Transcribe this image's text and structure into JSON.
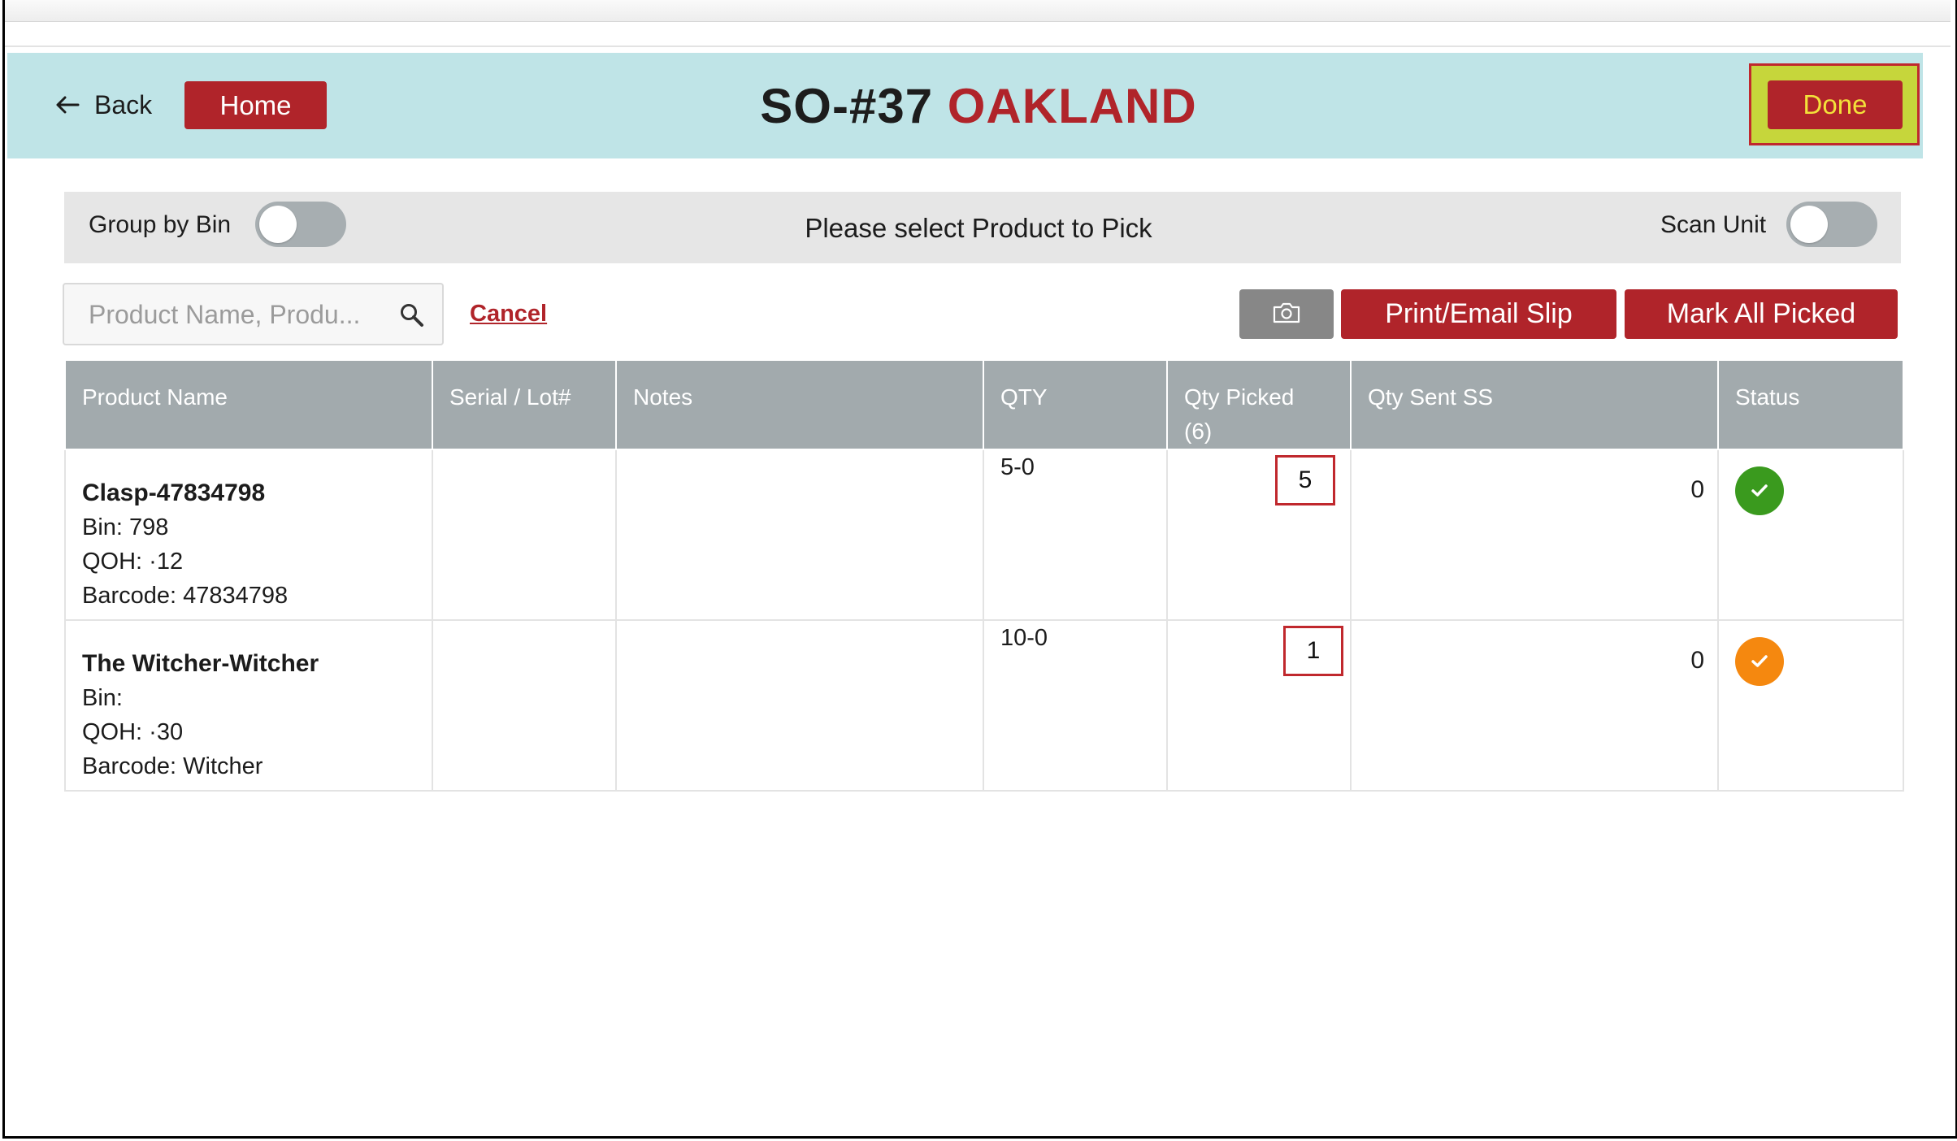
{
  "header": {
    "back_label": "Back",
    "home_label": "Home",
    "order_number": "SO-#37",
    "location": "OAKLAND",
    "done_label": "Done"
  },
  "toolbar": {
    "group_by_bin_label": "Group by Bin",
    "group_by_bin_on": false,
    "instruction": "Please select Product to Pick",
    "scan_unit_label": "Scan Unit",
    "scan_unit_on": false
  },
  "actions": {
    "search_placeholder": "Product Name, Produ...",
    "search_value": "",
    "cancel_label": "Cancel",
    "camera_icon": "camera-icon",
    "print_label": "Print/Email Slip",
    "mark_all_label": "Mark All Picked"
  },
  "table": {
    "columns": [
      "Product Name",
      "Serial / Lot#",
      "Notes",
      "QTY",
      "Qty Picked",
      "(6)",
      "Qty Sent SS",
      "Status"
    ],
    "rows": [
      {
        "name": "Clasp-47834798",
        "bin": "Bin: 798",
        "qoh": "QOH:  ·12",
        "barcode": "Barcode: 47834798",
        "serial": "",
        "notes": "",
        "qty": "5-0",
        "picked": "5",
        "sent": "0",
        "status": "complete",
        "status_color": "#3a9a1e"
      },
      {
        "name": "The Witcher-Witcher",
        "bin": "Bin:",
        "qoh": "QOH:  ·30",
        "barcode": "Barcode: Witcher",
        "serial": "",
        "notes": "",
        "qty": "10-0",
        "picked": "1",
        "sent": "0",
        "status": "partial",
        "status_color": "#f5880f"
      }
    ]
  },
  "colors": {
    "brand_red": "#b0242a",
    "header_bg": "#bfe4e7",
    "done_highlight": "#c6d63b",
    "table_header_bg": "#a2aaad"
  }
}
